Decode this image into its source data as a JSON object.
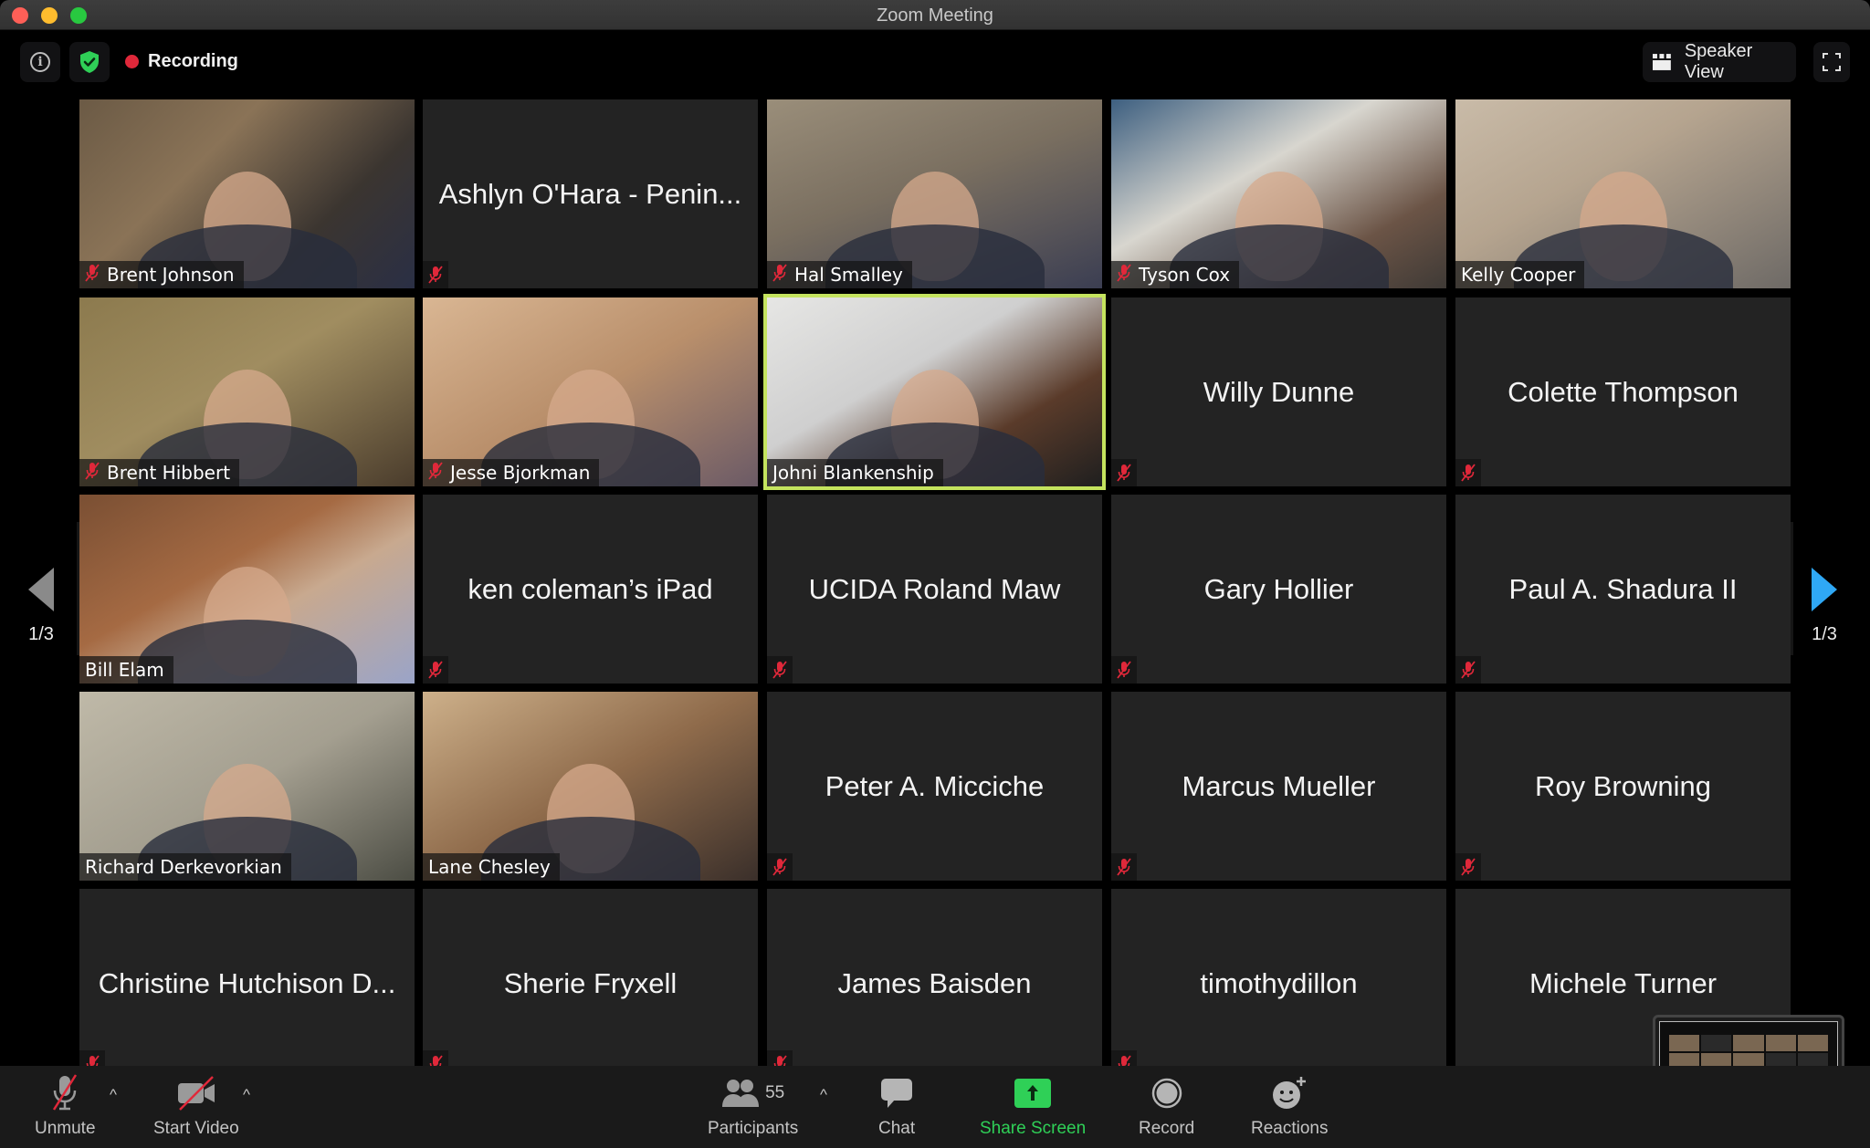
{
  "window": {
    "title": "Zoom Meeting"
  },
  "header": {
    "info_icon": "info-icon",
    "security_icon": "shield-check-icon",
    "recording_label": "Recording",
    "view_button_label": "Speaker View",
    "fullscreen_icon": "fullscreen-icon"
  },
  "pagination": {
    "left_page": "1/3",
    "right_page": "1/3"
  },
  "participants_grid": [
    {
      "name": "Brent Johnson",
      "video": true,
      "muted": true
    },
    {
      "name": "Ashlyn O'Hara - Penin...",
      "video": false,
      "muted": true
    },
    {
      "name": "Hal Smalley",
      "video": true,
      "muted": true
    },
    {
      "name": "Tyson Cox",
      "video": true,
      "muted": true
    },
    {
      "name": "Kelly Cooper",
      "video": true,
      "muted": false
    },
    {
      "name": "Brent Hibbert",
      "video": true,
      "muted": true
    },
    {
      "name": "Jesse Bjorkman",
      "video": true,
      "muted": true
    },
    {
      "name": "Johni Blankenship",
      "video": true,
      "muted": false,
      "active_speaker": true
    },
    {
      "name": "Willy Dunne",
      "video": false,
      "muted": true
    },
    {
      "name": "Colette Thompson",
      "video": false,
      "muted": true
    },
    {
      "name": "Bill Elam",
      "video": true,
      "muted": false
    },
    {
      "name": "ken coleman’s iPad",
      "video": false,
      "muted": true
    },
    {
      "name": "UCIDA Roland Maw",
      "video": false,
      "muted": true
    },
    {
      "name": "Gary Hollier",
      "video": false,
      "muted": true
    },
    {
      "name": "Paul A. Shadura II",
      "video": false,
      "muted": true
    },
    {
      "name": "Richard Derkevorkian",
      "video": true,
      "muted": false
    },
    {
      "name": "Lane Chesley",
      "video": true,
      "muted": false
    },
    {
      "name": "Peter A. Micciche",
      "video": false,
      "muted": true
    },
    {
      "name": "Marcus Mueller",
      "video": false,
      "muted": true
    },
    {
      "name": "Roy Browning",
      "video": false,
      "muted": true
    },
    {
      "name": "Christine Hutchison D...",
      "video": false,
      "muted": true
    },
    {
      "name": "Sherie Fryxell",
      "video": false,
      "muted": true
    },
    {
      "name": "James Baisden",
      "video": false,
      "muted": true
    },
    {
      "name": "timothydillon",
      "video": false,
      "muted": true
    },
    {
      "name": "Michele Turner",
      "video": false,
      "muted": false
    }
  ],
  "toolbar": {
    "unmute": {
      "label": "Unmute",
      "icon": "mic-muted-icon"
    },
    "start_video": {
      "label": "Start Video",
      "icon": "video-off-icon"
    },
    "participants": {
      "label": "Participants",
      "count": "55",
      "icon": "participants-icon"
    },
    "chat": {
      "label": "Chat",
      "icon": "chat-icon"
    },
    "share_screen": {
      "label": "Share Screen",
      "icon": "share-screen-icon"
    },
    "record": {
      "label": "Record",
      "icon": "record-icon"
    },
    "reactions": {
      "label": "Reactions",
      "icon": "reactions-icon"
    }
  },
  "colors": {
    "active_speaker_border": "#c4e35e",
    "muted_red": "#e0283a",
    "share_green": "#2fd057",
    "next_page_blue": "#2fa8f5",
    "recording_red": "#e0283a"
  }
}
